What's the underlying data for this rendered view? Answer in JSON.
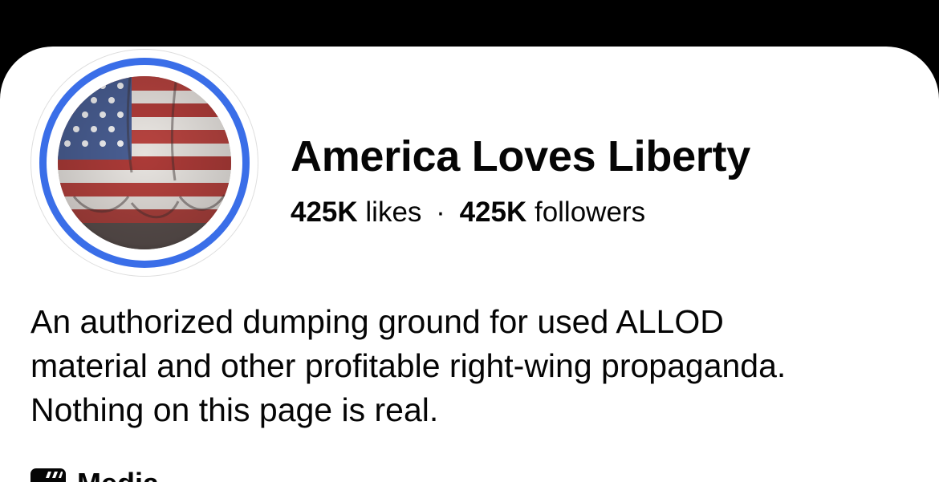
{
  "page": {
    "name": "America Loves Liberty",
    "likes_count": "425K",
    "likes_label": "likes",
    "separator": "·",
    "followers_count": "425K",
    "followers_label": "followers"
  },
  "bio": {
    "line1": "An authorized dumping ground for used ALLOD",
    "line2": "material and other profitable right-wing propaganda.",
    "line3": "Nothing on this page is real."
  },
  "media": {
    "icon": "clapperboard-icon",
    "label": "Media"
  },
  "colors": {
    "ring": "#3a6ee8",
    "text": "#050505",
    "background": "#ffffff"
  }
}
